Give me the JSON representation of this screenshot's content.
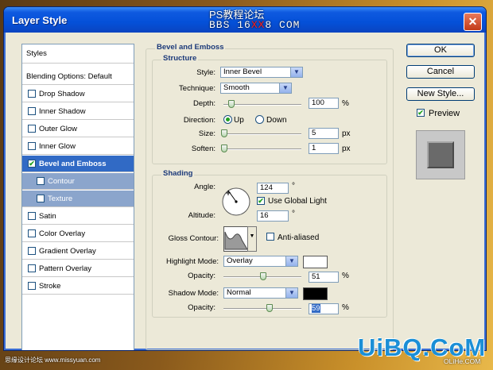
{
  "window": {
    "title": "Layer Style",
    "close_glyph": "✕"
  },
  "watermark": {
    "line1": "PS教程论坛",
    "line2_a": "BBS 16",
    "line2_b": "XX",
    "line2_c": "8 COM"
  },
  "left_list": {
    "styles": "Styles",
    "blending": "Blending Options: Default",
    "items": [
      {
        "label": "Drop Shadow",
        "checked": false
      },
      {
        "label": "Inner Shadow",
        "checked": false
      },
      {
        "label": "Outer Glow",
        "checked": false
      },
      {
        "label": "Inner Glow",
        "checked": false
      },
      {
        "label": "Bevel and Emboss",
        "checked": true
      },
      {
        "label": "Contour",
        "checked": false
      },
      {
        "label": "Texture",
        "checked": false
      },
      {
        "label": "Satin",
        "checked": false
      },
      {
        "label": "Color Overlay",
        "checked": false
      },
      {
        "label": "Gradient Overlay",
        "checked": false
      },
      {
        "label": "Pattern Overlay",
        "checked": false
      },
      {
        "label": "Stroke",
        "checked": false
      }
    ]
  },
  "bevel": {
    "title": "Bevel and Emboss",
    "structure": {
      "title": "Structure",
      "style_label": "Style:",
      "style_value": "Inner Bevel",
      "technique_label": "Technique:",
      "technique_value": "Smooth",
      "depth_label": "Depth:",
      "depth_value": "100",
      "depth_unit": "%",
      "depth_pct": 0.1,
      "direction_label": "Direction:",
      "dir_up": "Up",
      "dir_down": "Down",
      "direction_selected": "Up",
      "size_label": "Size:",
      "size_value": "5",
      "size_unit": "px",
      "soften_label": "Soften:",
      "soften_value": "1",
      "soften_unit": "px"
    },
    "shading": {
      "title": "Shading",
      "angle_label": "Angle:",
      "angle_value": "124",
      "angle_unit": "°",
      "use_global_light": "Use Global Light",
      "use_global_light_checked": true,
      "altitude_label": "Altitude:",
      "altitude_value": "16",
      "altitude_unit": "°",
      "gloss_label": "Gloss Contour:",
      "anti_aliased": "Anti-aliased",
      "anti_aliased_checked": false,
      "highlight_mode_label": "Highlight Mode:",
      "highlight_mode_value": "Overlay",
      "highlight_color": "#ffffff",
      "highlight_opacity_label": "Opacity:",
      "highlight_opacity_value": "51",
      "highlight_opacity_unit": "%",
      "highlight_opacity_pct": 0.51,
      "shadow_mode_label": "Shadow Mode:",
      "shadow_mode_value": "Normal",
      "shadow_color": "#000000",
      "shadow_opacity_label": "Opacity:",
      "shadow_opacity_value": "59",
      "shadow_opacity_unit": "%",
      "shadow_opacity_pct": 0.59
    }
  },
  "buttons": {
    "ok": "OK",
    "cancel": "Cancel",
    "new_style": "New Style...",
    "preview": "Preview",
    "preview_checked": true
  },
  "branding": {
    "logo": "UiBQ.CoM",
    "site_left": "思缘设计论坛 www.missyuan.com",
    "site_right": "OLiHe.COM"
  }
}
